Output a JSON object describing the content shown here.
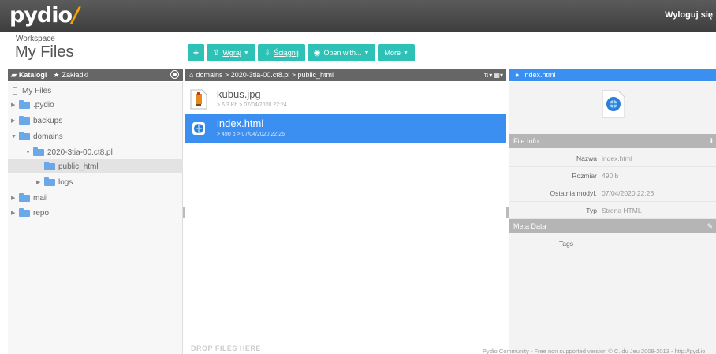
{
  "app": {
    "logo": "pydio",
    "logout": "Wyloguj się"
  },
  "workspace": {
    "label": "Workspace",
    "title": "My Files"
  },
  "toolbar": {
    "upload": "Wgraj",
    "download": "Ściągnij",
    "open_with": "Open with...",
    "more": "More"
  },
  "left_panel": {
    "tab_folders": "Katalogi",
    "tab_bookmarks": "Zakładki"
  },
  "breadcrumb": "domains > 2020-3tia-00.ct8.pl > public_html",
  "tree": {
    "root": "My Files",
    "items": [
      ".pydio",
      "backups",
      "domains",
      "2020-3tia-00.ct8.pl",
      "public_html",
      "logs",
      "mail",
      "repo"
    ]
  },
  "files": [
    {
      "name": "kubus.jpg",
      "meta": "> 6.3 Kb > 07/04/2020 22:24"
    },
    {
      "name": "index.html",
      "meta": "> 490 b > 07/04/2020 22:26"
    }
  ],
  "dropzone": "DROP FILES HERE",
  "info": {
    "title": "index.html",
    "file_info_label": "File Info",
    "fields": [
      {
        "key": "Nazwa",
        "value": "index.html"
      },
      {
        "key": "Rozmiar",
        "value": "490 b"
      },
      {
        "key": "Ostatnia modyf.",
        "value": "07/04/2020 22:26"
      },
      {
        "key": "Typ",
        "value": "Strona HTML"
      }
    ],
    "meta_label": "Meta Data",
    "tags_label": "Tags"
  },
  "footer": "Pydio Community - Free non supported version © C. du Jeu 2008-2013 - http://pyd.io"
}
